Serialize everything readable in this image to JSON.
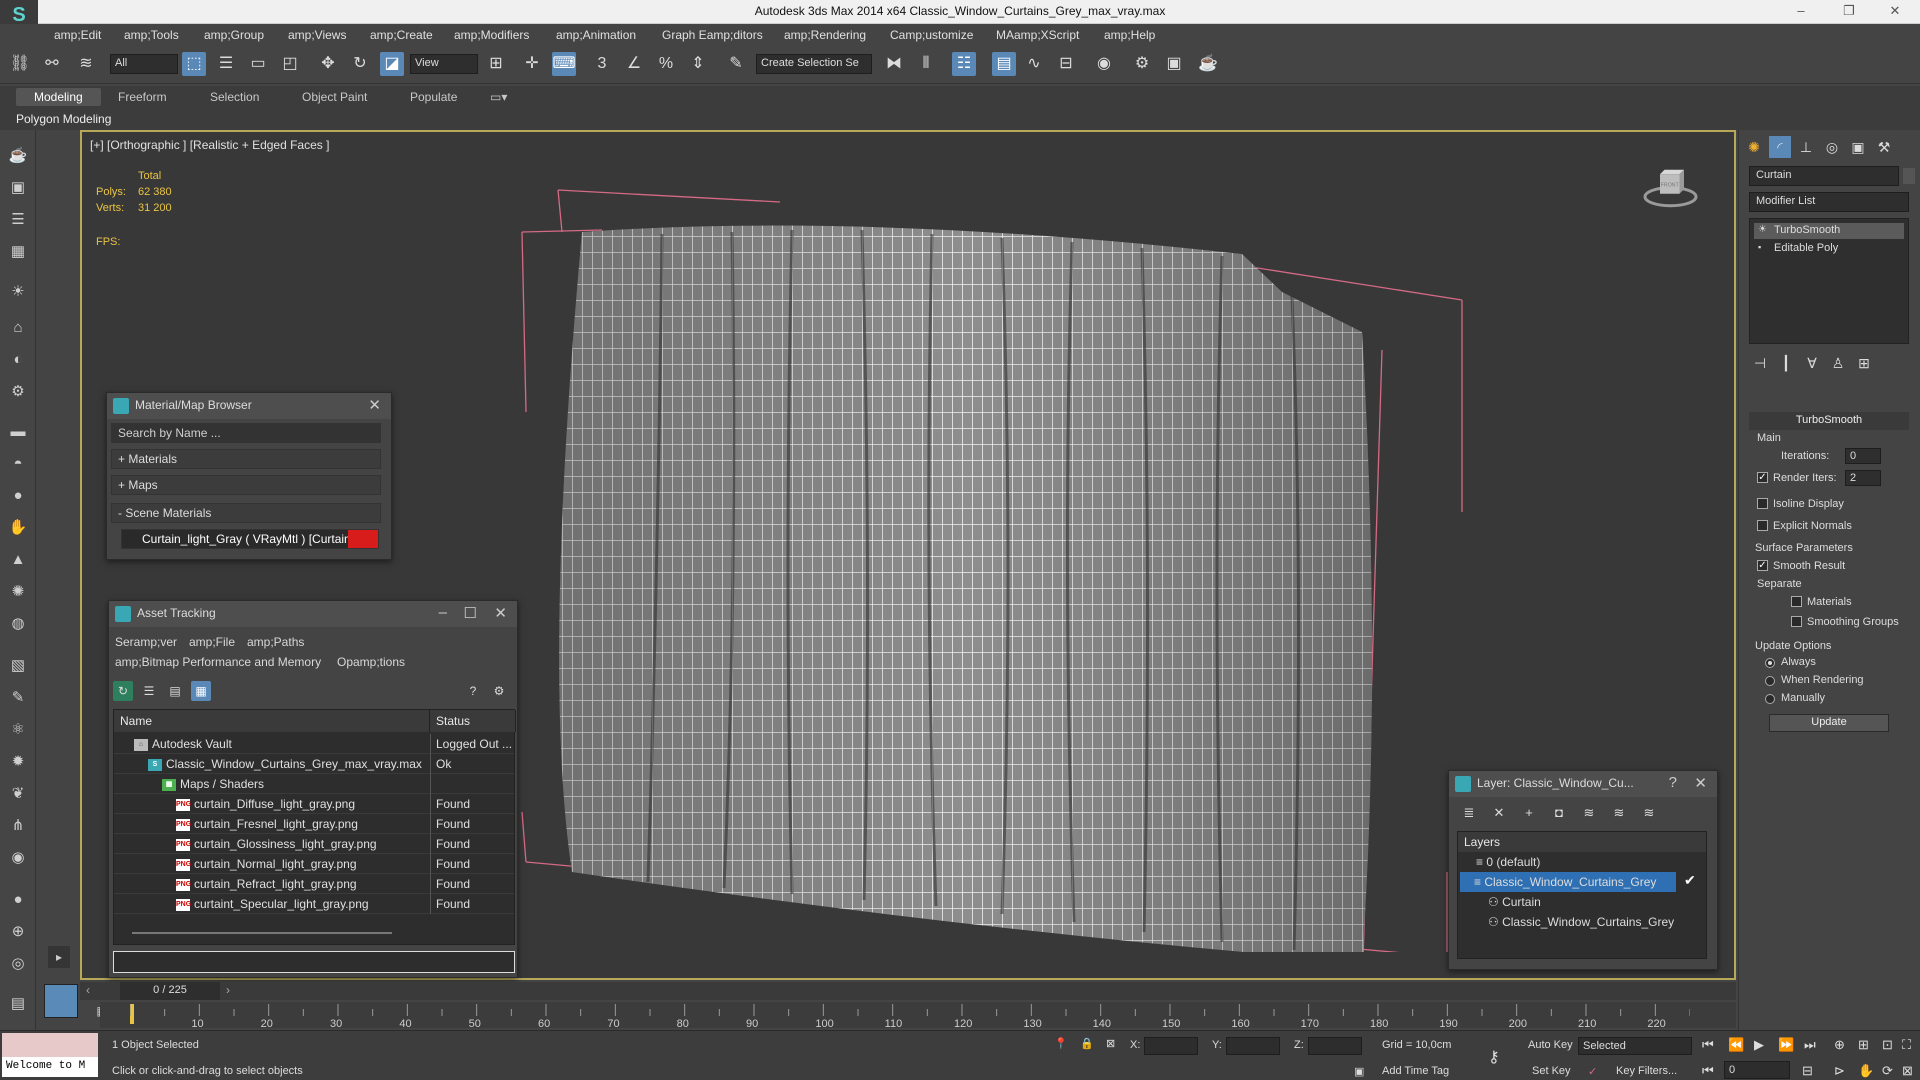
{
  "window": {
    "title": "Autodesk 3ds Max  2014 x64     Classic_Window_Curtains_Grey_max_vray.max",
    "controls": [
      "–",
      "❐",
      "✕"
    ]
  },
  "menu": [
    "amp;Edit",
    "amp;Tools",
    "amp;Group",
    "amp;Views",
    "amp;Create",
    "amp;Modifiers",
    "amp;Animation",
    "Graph Eamp;ditors",
    "amp;Rendering",
    "Camp;ustomize",
    "MAamp;XScript",
    "amp;Help"
  ],
  "toolbar": {
    "filter_value": "All",
    "refcoord_value": "View",
    "selection_set_placeholder": "Create Selection Se"
  },
  "ribbon": {
    "tabs": [
      "Modeling",
      "Freeform",
      "Selection",
      "Object Paint",
      "Populate"
    ],
    "active_tab": "Modeling",
    "sub_label": "Polygon Modeling"
  },
  "viewport": {
    "label": "[+] [Orthographic ] [Realistic + Edged Faces ]",
    "stats": {
      "total_label": "Total",
      "polys_label": "Polys:",
      "polys_value": "62 380",
      "verts_label": "Verts:",
      "verts_value": "31 200",
      "fps_label": "FPS:"
    },
    "viewcube_label": "FRONT"
  },
  "material_browser": {
    "title": "Material/Map Browser",
    "search_placeholder": "Search by Name ...",
    "groups": [
      "+ Materials",
      "+ Maps",
      "- Scene Materials"
    ],
    "selected_material": "Curtain_light_Gray  ( VRayMtl ) [Curtain]",
    "colors": {
      "swatch": "#d81b1b"
    }
  },
  "asset_tracking": {
    "title": "Asset Tracking",
    "menu_row1": [
      "Seramp;ver",
      "amp;File",
      "amp;Paths"
    ],
    "menu_row2": [
      "amp;Bitmap Performance and Memory",
      "Opamp;tions"
    ],
    "columns": [
      "Name",
      "Status"
    ],
    "rows": [
      {
        "name": "Autodesk Vault",
        "status": "Logged Out ..."
      },
      {
        "name": "Classic_Window_Curtains_Grey_max_vray.max",
        "status": "Ok"
      },
      {
        "name": "Maps / Shaders",
        "status": ""
      },
      {
        "name": "curtain_Diffuse_light_gray.png",
        "status": "Found"
      },
      {
        "name": "curtain_Fresnel_light_gray.png",
        "status": "Found"
      },
      {
        "name": "curtain_Glossiness_light_gray.png",
        "status": "Found"
      },
      {
        "name": "curtain_Normal_light_gray.png",
        "status": "Found"
      },
      {
        "name": "curtain_Refract_light_gray.png",
        "status": "Found"
      },
      {
        "name": "curtaint_Specular_light_gray.png",
        "status": "Found"
      }
    ]
  },
  "layer_panel": {
    "title": "Layer: Classic_Window_Cu...",
    "header": "Layers",
    "items": [
      "0 (default)",
      "Classic_Window_Curtains_Grey",
      "Curtain",
      "Classic_Window_Curtains_Grey"
    ]
  },
  "command_panel": {
    "object_name": "Curtain",
    "modifier_list": "Modifier List",
    "stack": [
      "TurboSmooth",
      "Editable Poly"
    ],
    "turbosmooth": {
      "title": "TurboSmooth",
      "main": "Main",
      "iterations_label": "Iterations:",
      "iterations_value": "0",
      "render_iters_label": "Render Iters:",
      "render_iters_value": "2",
      "isoline": "Isoline Display",
      "explicit": "Explicit Normals",
      "surface_params": "Surface Parameters",
      "smooth_result": "Smooth Result",
      "separate": "Separate",
      "materials": "Materials",
      "smoothing_groups": "Smoothing Groups",
      "update_options": "Update Options",
      "always": "Always",
      "when_rendering": "When Rendering",
      "manually": "Manually",
      "update_button": "Update"
    }
  },
  "timeline": {
    "slider_label": "0 / 225",
    "ticks": [
      "10",
      "20",
      "30",
      "40",
      "50",
      "60",
      "70",
      "80",
      "90",
      "100",
      "110",
      "120",
      "130",
      "140",
      "150",
      "160",
      "170",
      "180",
      "190",
      "200",
      "210",
      "220"
    ]
  },
  "status": {
    "maxscript": "Welcome to M",
    "selected": "1 Object Selected",
    "prompt": "Click or click-and-drag to select objects",
    "x_label": "X:",
    "y_label": "Y:",
    "z_label": "Z:",
    "grid": "Grid = 10,0cm",
    "add_time_tag": "Add Time Tag",
    "auto_key": "Auto Key",
    "set_key": "Set Key",
    "key_mode_value": "Selected",
    "key_filters": "Key Filters...",
    "frame_value": "0"
  }
}
